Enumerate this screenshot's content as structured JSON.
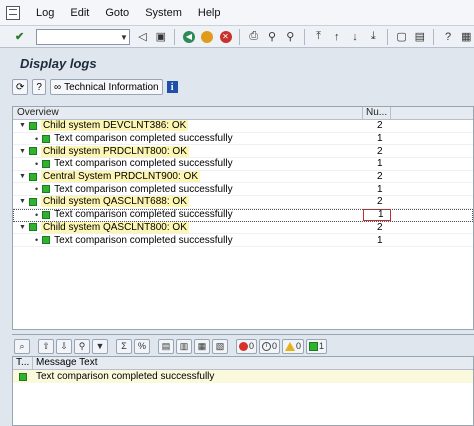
{
  "menubar": {
    "items": [
      "Log",
      "Edit",
      "Goto",
      "System",
      "Help"
    ]
  },
  "toolbar": {
    "command_value": ""
  },
  "page": {
    "title": "Display logs"
  },
  "app_toolbar": {
    "technical_info_label": "Technical Information"
  },
  "tree": {
    "col_overview": "Overview",
    "col_num": "Nu...",
    "rows": [
      {
        "kind": "parent",
        "label": "Child system DEVCLNT386: OK",
        "num": "2"
      },
      {
        "kind": "child",
        "label": "Text comparison completed successfully",
        "num": "1"
      },
      {
        "kind": "parent",
        "label": "Child system PRDCLNT800: OK",
        "num": "2"
      },
      {
        "kind": "child",
        "label": "Text comparison completed successfully",
        "num": "1"
      },
      {
        "kind": "parent",
        "label": "Central System PRDCLNT900: OK",
        "num": "2"
      },
      {
        "kind": "child",
        "label": "Text comparison completed successfully",
        "num": "1"
      },
      {
        "kind": "parent",
        "label": "Child system QASCLNT688: OK",
        "num": "2"
      },
      {
        "kind": "child",
        "label": "Text comparison completed successfully",
        "num": "1"
      },
      {
        "kind": "parent",
        "label": "Child system QASCLNT800: OK",
        "num": "2"
      },
      {
        "kind": "child",
        "label": "Text comparison completed successfully",
        "num": "1"
      }
    ]
  },
  "msg_toolbar": {
    "errors": "0",
    "warnings": "0",
    "info": "0",
    "success": "1"
  },
  "messages": {
    "col_type": "T...",
    "col_text": "Message Text",
    "rows": [
      {
        "text": "Text comparison completed successfully"
      }
    ]
  },
  "colors": {
    "highlight": "#fdf6b2",
    "success_green": "#2fb32f",
    "background": "#dfe6ee"
  }
}
